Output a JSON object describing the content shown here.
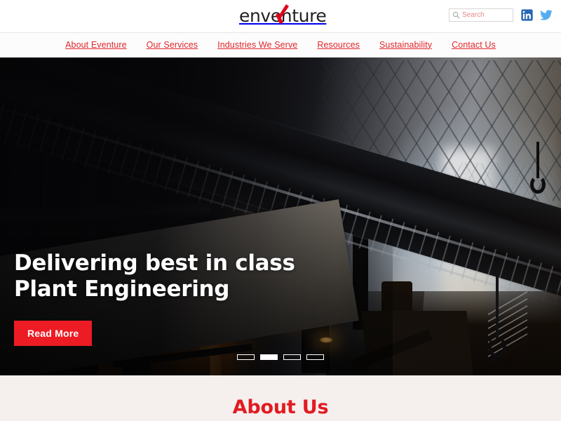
{
  "header": {
    "logo": {
      "text": "enventure",
      "accent_color": "#e2001a",
      "text_color": "#231f20",
      "icon": "brand-logo"
    },
    "search": {
      "placeholder": "Search",
      "value": "",
      "icon": "search-icon"
    },
    "social": [
      {
        "name": "linkedin",
        "label": "LinkedIn",
        "icon": "linkedin-icon",
        "color": "#2867b2"
      },
      {
        "name": "twitter",
        "label": "Twitter",
        "icon": "twitter-icon",
        "color": "#55acee"
      }
    ]
  },
  "nav": {
    "color": "#e0262c",
    "items": [
      {
        "label": "About Eventure"
      },
      {
        "label": "Our Services"
      },
      {
        "label": "Industries We Serve"
      },
      {
        "label": "Resources"
      },
      {
        "label": "Sustainability"
      },
      {
        "label": "Contact Us"
      }
    ]
  },
  "hero": {
    "title": "Delivering best in class\nPlant Engineering",
    "title_line1": "Delivering best in class",
    "title_line2": "Plant Engineering",
    "cta_label": "Read More",
    "cta_color": "#ed1c24",
    "image_description": "Dark industrial steel plant interior with orange structural beams, overhead catwalk and bright light shaft",
    "carousel": {
      "total": 4,
      "active_index": 2,
      "slides": [
        "1",
        "2",
        "3",
        "4"
      ]
    }
  },
  "about": {
    "title": "About Us",
    "title_color": "#e11b22",
    "background": "#f5f0ee"
  }
}
